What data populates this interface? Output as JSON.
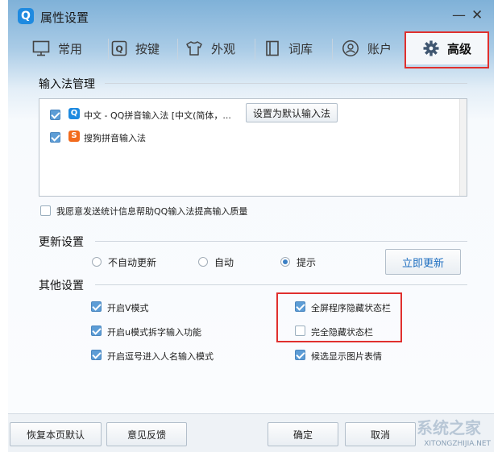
{
  "window": {
    "title": "属性设置",
    "logo_letter": "Q",
    "min_glyph": "—",
    "close_glyph": "✕"
  },
  "tabs": [
    {
      "label": "常用",
      "icon": "monitor-icon"
    },
    {
      "label": "按键",
      "icon": "key-icon"
    },
    {
      "label": "外观",
      "icon": "shirt-icon"
    },
    {
      "label": "词库",
      "icon": "book-icon"
    },
    {
      "label": "账户",
      "icon": "user-icon"
    },
    {
      "label": "高级",
      "icon": "gear-icon",
      "active": true
    }
  ],
  "ime_manage": {
    "title": "输入法管理",
    "items": [
      {
        "label": "中文 - QQ拼音输入法 [中文(简体，...",
        "checked": true,
        "icon": "qq-ime-icon",
        "icon_letter": "Q"
      },
      {
        "label": "搜狗拼音输入法",
        "checked": true,
        "icon": "sogou-ime-icon",
        "icon_letter": "S"
      }
    ],
    "set_default_label": "设置为默认输入法",
    "stats_label": "我愿意发送统计信息帮助QQ输入法提高输入质量",
    "stats_checked": false
  },
  "update": {
    "title": "更新设置",
    "options": [
      "不自动更新",
      "自动",
      "提示"
    ],
    "selected": "提示",
    "update_now_label": "立即更新"
  },
  "other": {
    "title": "其他设置",
    "left": [
      {
        "label": "开启V模式",
        "checked": true
      },
      {
        "label": "开启u模式拆字输入功能",
        "checked": true
      },
      {
        "label": "开启逗号进入人名输入模式",
        "checked": true
      }
    ],
    "right": [
      {
        "label": "全屏程序隐藏状态栏",
        "checked": true
      },
      {
        "label": "完全隐藏状态栏",
        "checked": false
      },
      {
        "label": "候选显示图片表情",
        "checked": true
      }
    ]
  },
  "footer": {
    "restore_label": "恢复本页默认",
    "feedback_label": "意见反馈",
    "ok_label": "确定",
    "cancel_label": "取消"
  },
  "watermark": {
    "text": "系统之家",
    "sub": "XITONGZHIJIA.NET"
  },
  "colors": {
    "highlight_border": "#e0302e",
    "accent": "#1e8ae0",
    "check_fill": "#5d9dd6"
  }
}
